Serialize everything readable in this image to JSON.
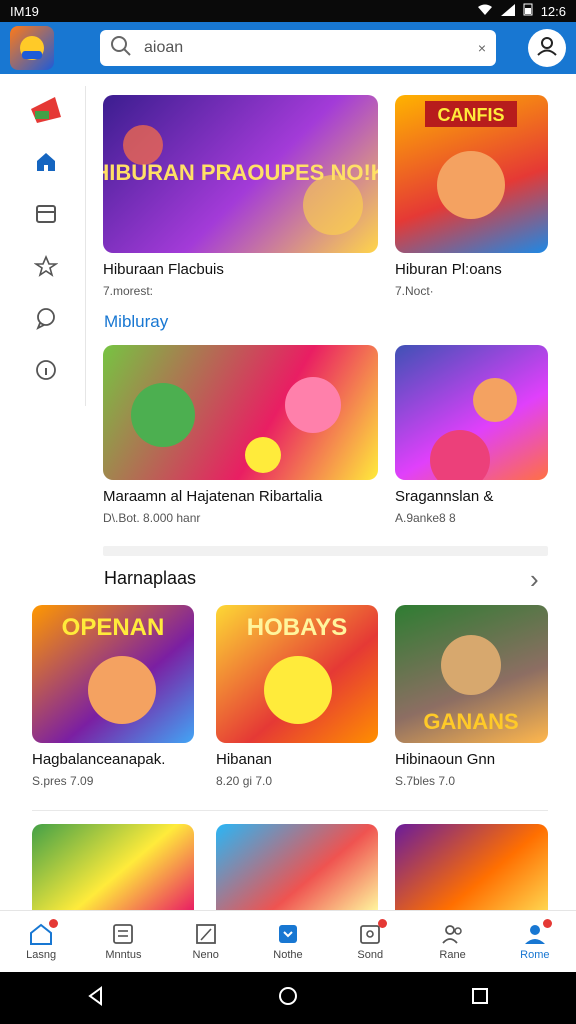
{
  "status": {
    "time_left": "IM19",
    "time_right": "12:6"
  },
  "search": {
    "placeholder": "aioan",
    "clear": "×"
  },
  "sidebar": {
    "items": [
      {
        "icon": "brand-icon"
      },
      {
        "icon": "home-icon"
      },
      {
        "icon": "card-icon"
      },
      {
        "icon": "star-icon"
      },
      {
        "icon": "chat-icon"
      },
      {
        "icon": "info-icon"
      }
    ]
  },
  "featured": [
    {
      "title": "Hiburaan Flacbuis",
      "sub": "7.morest:",
      "art": "HIBURAN PRAOUPES NO!K",
      "colors": [
        "#3b1d8f",
        "#a33bd8",
        "#ffd54a"
      ]
    },
    {
      "title": "Hiburan Pl:oans",
      "sub": "7.Noct·",
      "art": "CANFIS",
      "colors": [
        "#ffb300",
        "#e53935",
        "#1e88e5"
      ]
    }
  ],
  "section1": {
    "title": "Mibluray"
  },
  "row2": [
    {
      "title": "Maraamn al Hajatenan Ribartalia",
      "sub": "D\\.Bot. 8.000 hanr",
      "colors": [
        "#76c442",
        "#e91e63",
        "#ffeb3b"
      ]
    },
    {
      "title": "Sragannslan &",
      "sub": "A.9anke8 8",
      "colors": [
        "#3f51b5",
        "#e040fb",
        "#ff7043"
      ]
    }
  ],
  "section2": {
    "title": "Harnaplaas",
    "chevron": "›"
  },
  "row3": [
    {
      "title": "Hagbalanceanapak.",
      "sub": "S.pres 7.09",
      "art": "OPENAN",
      "colors": [
        "#ff9800",
        "#7b1fa2",
        "#42a5f5"
      ]
    },
    {
      "title": "Hibanan",
      "sub": "8.20 gi 7.0",
      "art": "HOBAYS",
      "colors": [
        "#fdd835",
        "#e53935",
        "#ff8f00"
      ]
    },
    {
      "title": "Hibinaoun Gnn",
      "sub": "S.7bles 7.0",
      "art": "GANANS",
      "colors": [
        "#2e7d32",
        "#8d6e63",
        "#ffb74d"
      ]
    }
  ],
  "row4": [
    {
      "colors": [
        "#43a047",
        "#ffeb3b",
        "#e91e63"
      ]
    },
    {
      "colors": [
        "#29b6f6",
        "#ef5350",
        "#fff59d"
      ]
    },
    {
      "colors": [
        "#6a1b9a",
        "#ff6f00",
        "#ffd54f"
      ]
    }
  ],
  "tabs": [
    {
      "label": "Lasng",
      "icon": "home-icon",
      "badge": true,
      "accent": true
    },
    {
      "label": "Mnntus",
      "icon": "list-icon",
      "badge": false
    },
    {
      "label": "Neno",
      "icon": "edit-icon",
      "badge": false
    },
    {
      "label": "Nothe",
      "icon": "bookmark-icon",
      "badge": false,
      "accent": true
    },
    {
      "label": "Sond",
      "icon": "store-icon",
      "badge": true
    },
    {
      "label": "Rane",
      "icon": "people-icon",
      "badge": false
    },
    {
      "label": "Rome",
      "icon": "profile-icon",
      "badge": true,
      "accent": true
    }
  ],
  "accent": "#1877d2"
}
